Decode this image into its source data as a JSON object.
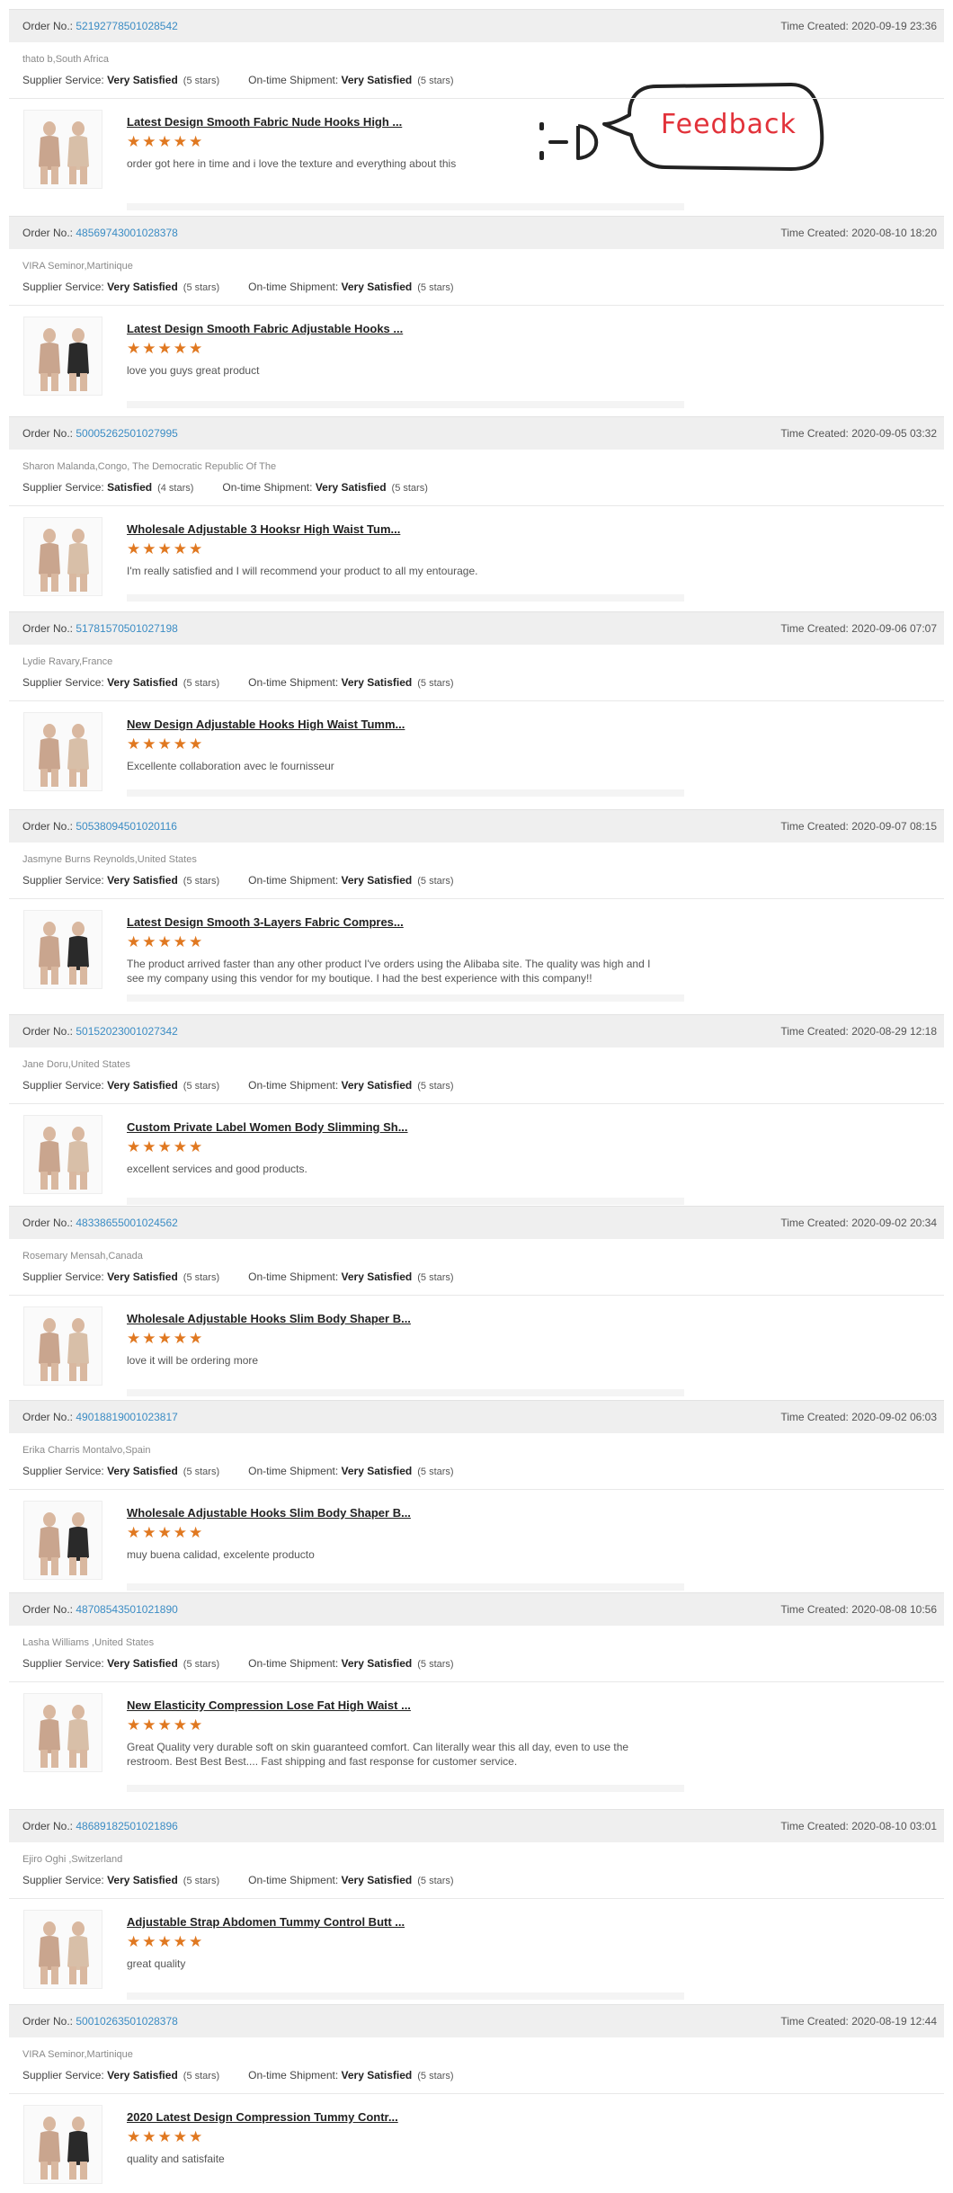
{
  "feedback_badge": {
    "emoticon": ":-D",
    "label": "Feedback"
  },
  "labels": {
    "order_no": "Order No.:",
    "time_created": "Time Created:",
    "supplier_service": "Supplier Service:",
    "ontime_shipment": "On-time Shipment:"
  },
  "colors": {
    "link": "#3b8cc4",
    "star": "#e07820",
    "feedback_red": "#e2323a",
    "header_bg": "#efefef"
  },
  "orders": [
    {
      "order_no": "52192778501028542",
      "time": "2020-09-19 23:36",
      "buyer": "thato b,South Africa",
      "supplier_rating": "Very Satisfied",
      "supplier_stars": "(5 stars)",
      "shipment_rating": "Very Satisfied",
      "shipment_stars": "(5 stars)",
      "product": "Latest Design Smooth Fabric Nude Hooks High ...",
      "stars": "★★★★★",
      "comment": "order got here in time and i love the texture and everything about this"
    },
    {
      "order_no": "48569743001028378",
      "time": "2020-08-10 18:20",
      "buyer": "VIRA Seminor,Martinique",
      "supplier_rating": "Very Satisfied",
      "supplier_stars": "(5 stars)",
      "shipment_rating": "Very Satisfied",
      "shipment_stars": "(5 stars)",
      "product": "Latest Design Smooth Fabric Adjustable Hooks ...",
      "stars": "★★★★★",
      "comment": "love you guys great product"
    },
    {
      "order_no": "50005262501027995",
      "time": "2020-09-05 03:32",
      "buyer": "Sharon Malanda,Congo, The Democratic Republic Of The",
      "supplier_rating": "Satisfied",
      "supplier_stars": "(4 stars)",
      "shipment_rating": "Very Satisfied",
      "shipment_stars": "(5 stars)",
      "product": "Wholesale Adjustable 3 Hooksr High Waist Tum...",
      "stars": "★★★★★",
      "comment": "I'm really satisfied and I will recommend your product to all my entourage."
    },
    {
      "order_no": "51781570501027198",
      "time": "2020-09-06 07:07",
      "buyer": "Lydie Ravary,France",
      "supplier_rating": "Very Satisfied",
      "supplier_stars": "(5 stars)",
      "shipment_rating": "Very Satisfied",
      "shipment_stars": "(5 stars)",
      "product": "New Design Adjustable Hooks High Waist Tumm...",
      "stars": "★★★★★",
      "comment": "Excellente collaboration avec le fournisseur"
    },
    {
      "order_no": "50538094501020116",
      "time": "2020-09-07 08:15",
      "buyer": "Jasmyne Burns Reynolds,United States",
      "supplier_rating": "Very Satisfied",
      "supplier_stars": "(5 stars)",
      "shipment_rating": "Very Satisfied",
      "shipment_stars": "(5 stars)",
      "product": "Latest Design Smooth 3-Layers Fabric Compres...",
      "stars": "★★★★★",
      "comment": "The product arrived faster than any other product I've orders using the Alibaba site. The quality was high and I see my company using this vendor for my boutique. I had the best experience with this company!!"
    },
    {
      "order_no": "50152023001027342",
      "time": "2020-08-29 12:18",
      "buyer": "Jane Doru,United States",
      "supplier_rating": "Very Satisfied",
      "supplier_stars": "(5 stars)",
      "shipment_rating": "Very Satisfied",
      "shipment_stars": "(5 stars)",
      "product": "Custom Private Label Women Body Slimming Sh...",
      "stars": "★★★★★",
      "comment": "excellent services and good products."
    },
    {
      "order_no": "48338655001024562",
      "time": "2020-09-02 20:34",
      "buyer": "Rosemary Mensah,Canada",
      "supplier_rating": "Very Satisfied",
      "supplier_stars": "(5 stars)",
      "shipment_rating": "Very Satisfied",
      "shipment_stars": "(5 stars)",
      "product": "Wholesale Adjustable Hooks Slim Body Shaper B...",
      "stars": "★★★★★",
      "comment": "love it will be ordering more"
    },
    {
      "order_no": "49018819001023817",
      "time": "2020-09-02 06:03",
      "buyer": "Erika Charris Montalvo,Spain",
      "supplier_rating": "Very Satisfied",
      "supplier_stars": "(5 stars)",
      "shipment_rating": "Very Satisfied",
      "shipment_stars": "(5 stars)",
      "product": "Wholesale Adjustable Hooks Slim Body Shaper B...",
      "stars": "★★★★★",
      "comment": "muy buena calidad, excelente producto"
    },
    {
      "order_no": "48708543501021890",
      "time": "2020-08-08 10:56",
      "buyer": "Lasha Williams ,United States",
      "supplier_rating": "Very Satisfied",
      "supplier_stars": "(5 stars)",
      "shipment_rating": "Very Satisfied",
      "shipment_stars": "(5 stars)",
      "product": "New Elasticity Compression Lose Fat High Waist ...",
      "stars": "★★★★★",
      "comment": "Great Quality very durable soft on skin guaranteed comfort. Can literally wear this all day, even to use the restroom. Best Best Best.... Fast shipping and fast response for customer service."
    },
    {
      "order_no": "48689182501021896",
      "time": "2020-08-10 03:01",
      "buyer": "Ejiro Oghi ,Switzerland",
      "supplier_rating": "Very Satisfied",
      "supplier_stars": "(5 stars)",
      "shipment_rating": "Very Satisfied",
      "shipment_stars": "(5 stars)",
      "product": "Adjustable Strap Abdomen Tummy Control Butt ...",
      "stars": "★★★★★",
      "comment": "great quality"
    },
    {
      "order_no": "50010263501028378",
      "time": "2020-08-19 12:44",
      "buyer": "VIRA Seminor,Martinique",
      "supplier_rating": "Very Satisfied",
      "supplier_stars": "(5 stars)",
      "shipment_rating": "Very Satisfied",
      "shipment_stars": "(5 stars)",
      "product": "2020 Latest Design Compression Tummy Contr...",
      "stars": "★★★★★",
      "comment": "quality and satisfaite"
    }
  ]
}
